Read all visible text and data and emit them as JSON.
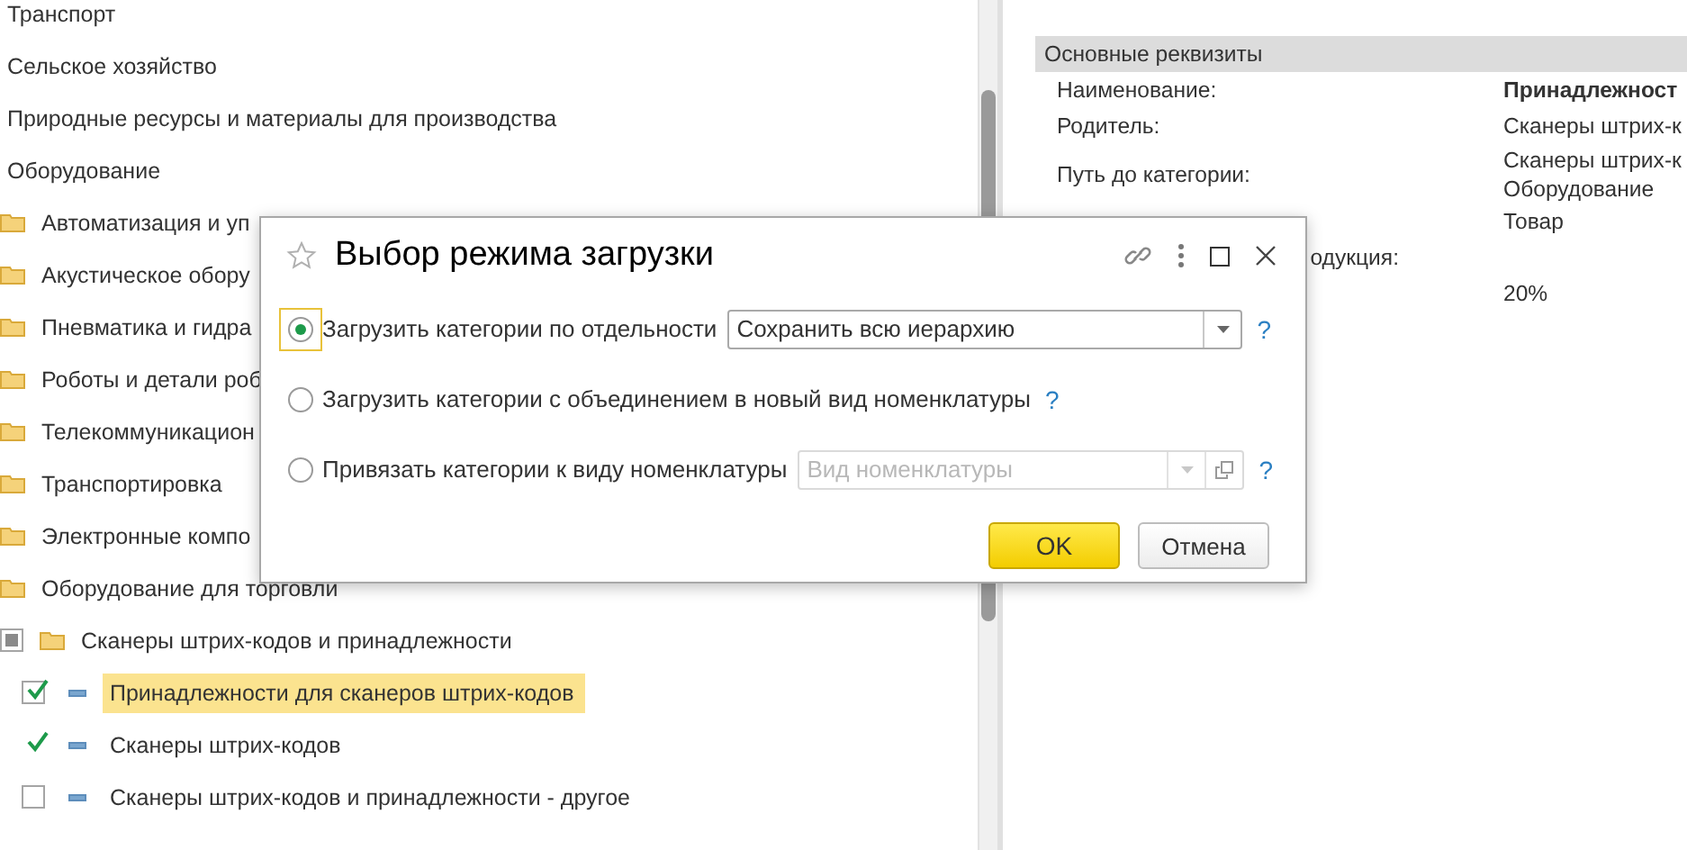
{
  "tree": [
    {
      "label": "Транспорт",
      "kind": "plain",
      "selected": false
    },
    {
      "label": "Сельское хозяйство",
      "kind": "plain",
      "selected": false
    },
    {
      "label": "Природные ресурсы и материалы для производства",
      "kind": "plain",
      "selected": false
    },
    {
      "label": "Оборудование",
      "kind": "plain",
      "selected": false,
      "children": [
        {
          "label": "Автоматизация и уп",
          "kind": "folder",
          "selected": false
        },
        {
          "label": "Акустическое обору",
          "kind": "folder",
          "selected": false
        },
        {
          "label": "Пневматика и гидра",
          "kind": "folder",
          "selected": false
        },
        {
          "label": "Роботы и детали роб",
          "kind": "folder",
          "selected": false
        },
        {
          "label": "Телекоммуникацион",
          "kind": "folder",
          "selected": false
        },
        {
          "label": "Транспортировка",
          "kind": "folder",
          "selected": false
        },
        {
          "label": "Электронные компо",
          "kind": "folder",
          "selected": false
        },
        {
          "label": "Оборудование для торговли",
          "kind": "folder",
          "selected": false,
          "children": [
            {
              "label": "Сканеры штрих-кодов и принадлежности",
              "kind": "folder",
              "checked": false,
              "partial": true,
              "boxed": true,
              "selected": false,
              "children": [
                {
                  "label": "Принадлежности для сканеров штрих-кодов",
                  "kind": "item",
                  "checked": true,
                  "partial": false,
                  "boxed": true,
                  "selected": true
                },
                {
                  "label": "Сканеры штрих-кодов",
                  "kind": "item",
                  "checked": true,
                  "partial": false,
                  "boxed": false,
                  "selected": false
                },
                {
                  "label": "Сканеры штрих-кодов и принадлежности - другое",
                  "kind": "item",
                  "checked": false,
                  "partial": false,
                  "boxed": true,
                  "selected": false
                }
              ]
            }
          ]
        }
      ]
    }
  ],
  "details": {
    "header": "Основные реквизиты",
    "rows": [
      {
        "label": "Наименование:",
        "values": [
          "Принадлежност"
        ],
        "bold": true
      },
      {
        "label": "Родитель:",
        "values": [
          "Сканеры штрих-к"
        ]
      },
      {
        "label": "Путь до категории:",
        "values": [
          "Сканеры штрих-к",
          "Оборудование"
        ]
      },
      {
        "values": [
          "Товар"
        ]
      },
      {
        "label": "одукция:",
        "label_cut": true,
        "values": []
      },
      {
        "values": [
          "20%"
        ]
      }
    ]
  },
  "dialog": {
    "title": "Выбор режима загрузки",
    "options": [
      {
        "label": "Загрузить категории по отдельности",
        "selected": true,
        "field": {
          "value": "Сохранить всю иерархию",
          "disabled": false
        },
        "help": "?"
      },
      {
        "label": "Загрузить категории с объединением в новый вид номенклатуры",
        "selected": false,
        "help": "?"
      },
      {
        "label": "Привязать категории к виду номенклатуры",
        "selected": false,
        "field": {
          "placeholder": "Вид номенклатуры",
          "disabled": true
        },
        "help": "?"
      }
    ],
    "buttons": [
      {
        "label": "OK",
        "kind": "primary"
      },
      {
        "label": "Отмена",
        "kind": "secondary"
      }
    ]
  }
}
